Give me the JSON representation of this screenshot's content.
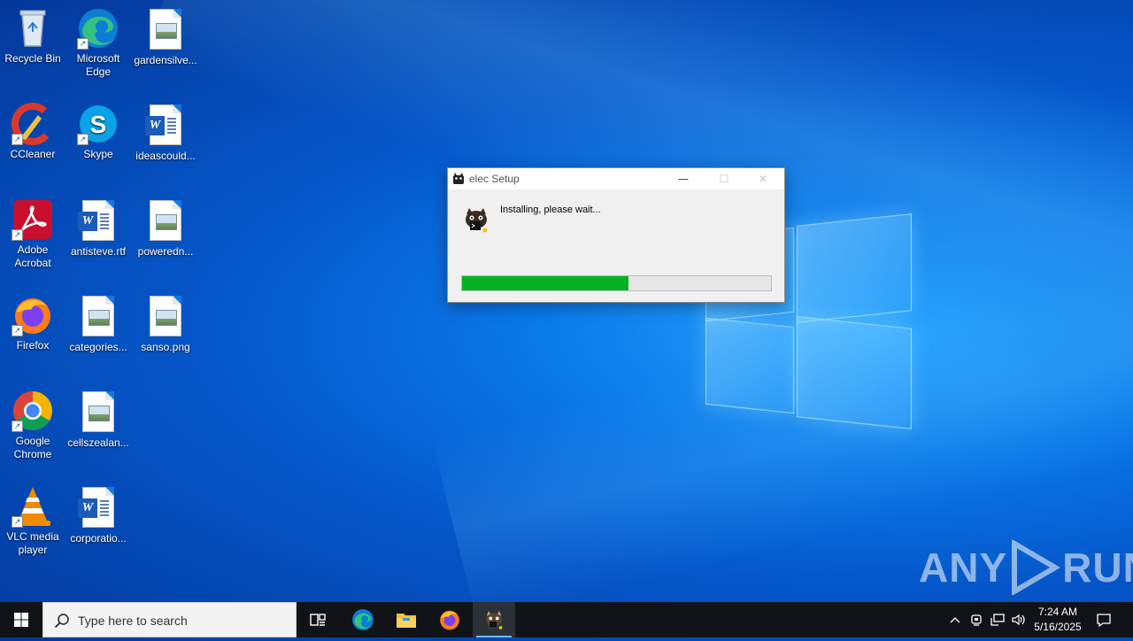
{
  "desktop": {
    "icons": [
      {
        "label": "Recycle Bin",
        "icon": "recycle-bin-icon"
      },
      {
        "label": "Microsoft Edge",
        "icon": "edge-icon"
      },
      {
        "label": "gardensilve...",
        "icon": "image-file-icon"
      },
      {
        "label": "CCleaner",
        "icon": "ccleaner-icon"
      },
      {
        "label": "Skype",
        "icon": "skype-icon"
      },
      {
        "label": "ideascould...",
        "icon": "word-document-icon"
      },
      {
        "label": "Adobe Acrobat",
        "icon": "acrobat-icon"
      },
      {
        "label": "antisteve.rtf",
        "icon": "word-document-icon"
      },
      {
        "label": "poweredn...",
        "icon": "image-file-icon"
      },
      {
        "label": "Firefox",
        "icon": "firefox-icon"
      },
      {
        "label": "categories...",
        "icon": "image-file-icon"
      },
      {
        "label": "sanso.png",
        "icon": "image-file-icon"
      },
      {
        "label": "Google Chrome",
        "icon": "chrome-icon"
      },
      {
        "label": "cellszealan...",
        "icon": "image-file-icon"
      },
      {
        "label": "VLC media player",
        "icon": "vlc-icon"
      },
      {
        "label": "corporatio...",
        "icon": "word-document-icon"
      }
    ]
  },
  "dialog": {
    "title": "elec Setup",
    "status": "Installing, please wait...",
    "progress": 0.54,
    "progress_color": "#06b025",
    "minimize": "—",
    "maximize": "☐",
    "close": "✕"
  },
  "watermark": {
    "left": "ANY",
    "right": "RUN"
  },
  "taskbar": {
    "search_placeholder": "Type here to search",
    "pinned": [
      "task-view-icon",
      "edge-icon",
      "file-explorer-icon",
      "firefox-icon",
      "elec-setup-icon"
    ],
    "time": "7:24 AM",
    "date": "5/16/2025"
  }
}
